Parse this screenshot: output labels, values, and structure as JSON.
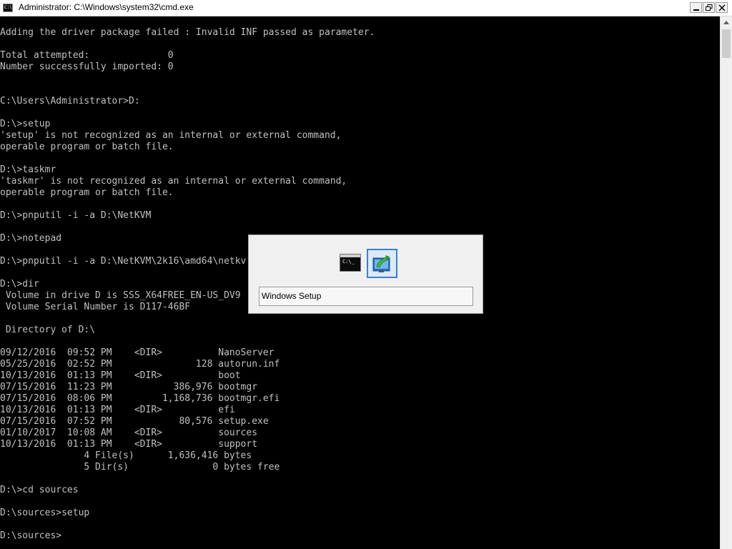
{
  "window": {
    "title": "Administrator: C:\\Windows\\system32\\cmd.exe",
    "icon_text": "C:\\"
  },
  "controls": {
    "minimize_icon": "minimize-icon",
    "maximize_icon": "restore-icon",
    "close_icon": "close-icon"
  },
  "console": {
    "lines": [
      "Adding the driver package failed : Invalid INF passed as parameter.",
      "",
      "Total attempted:              0",
      "Number successfully imported: 0",
      "",
      "",
      "C:\\Users\\Administrator>D:",
      "",
      "D:\\>setup",
      "'setup' is not recognized as an internal or external command,",
      "operable program or batch file.",
      "",
      "D:\\>taskmr",
      "'taskmr' is not recognized as an internal or external command,",
      "operable program or batch file.",
      "",
      "D:\\>pnputil -i -a D:\\NetKVM",
      "",
      "D:\\>notepad",
      "",
      "D:\\>pnputil -i -a D:\\NetKVM\\2k16\\amd64\\netkv",
      "",
      "D:\\>dir",
      " Volume in drive D is SSS_X64FREE_EN-US_DV9",
      " Volume Serial Number is D117-46BF",
      "",
      " Directory of D:\\",
      "",
      "09/12/2016  09:52 PM    <DIR>          NanoServer",
      "05/25/2016  02:52 PM               128 autorun.inf",
      "10/13/2016  01:13 PM    <DIR>          boot",
      "07/15/2016  11:23 PM           386,976 bootmgr",
      "07/15/2016  08:06 PM         1,168,736 bootmgr.efi",
      "10/13/2016  01:13 PM    <DIR>          efi",
      "07/15/2016  07:52 PM            80,576 setup.exe",
      "01/10/2017  10:08 AM    <DIR>          sources",
      "10/13/2016  01:13 PM    <DIR>          support",
      "               4 File(s)      1,636,416 bytes",
      "               5 Dir(s)               0 bytes free",
      "",
      "D:\\>cd sources",
      "",
      "D:\\sources>setup",
      "",
      "D:\\sources>"
    ]
  },
  "switcher": {
    "items": [
      {
        "name": "cmd-window-thumbnail",
        "icon_text": "C:\\_"
      },
      {
        "name": "windows-setup-thumbnail",
        "selected": true
      }
    ],
    "caption": "Windows Setup"
  },
  "colors": {
    "console_bg": "#000000",
    "console_fg": "#c0c0c0",
    "selection_accent": "#3a7fd6"
  }
}
